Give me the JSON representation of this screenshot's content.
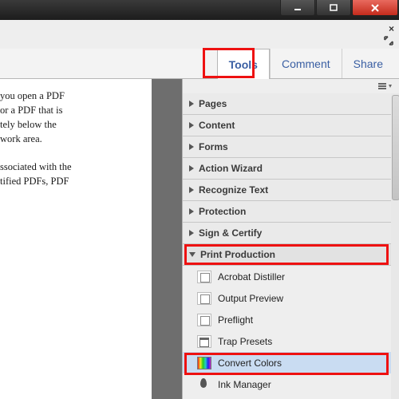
{
  "tabs": {
    "tools": "Tools",
    "comment": "Comment",
    "share": "Share"
  },
  "doc": {
    "p1_l1": "you open a PDF",
    "p1_l2": "or a PDF that is",
    "p1_l3": "tely below the",
    "p1_l4": "work area.",
    "p2_l1": "ssociated with the",
    "p2_l2": "tified PDFs, PDF"
  },
  "sections": {
    "pages": "Pages",
    "content": "Content",
    "forms": "Forms",
    "action_wizard": "Action Wizard",
    "recognize_text": "Recognize Text",
    "protection": "Protection",
    "sign_certify": "Sign & Certify",
    "print_production": "Print Production"
  },
  "tools": {
    "acrobat_distiller": "Acrobat Distiller",
    "output_preview": "Output Preview",
    "preflight": "Preflight",
    "trap_presets": "Trap Presets",
    "convert_colors": "Convert Colors",
    "ink_manager": "Ink Manager"
  }
}
